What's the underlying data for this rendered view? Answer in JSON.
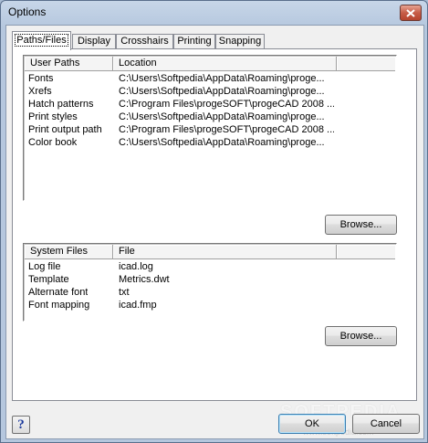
{
  "window": {
    "title": "Options"
  },
  "tabs": [
    {
      "label": "Paths/Files",
      "active": true
    },
    {
      "label": "Display"
    },
    {
      "label": "Crosshairs"
    },
    {
      "label": "Printing"
    },
    {
      "label": "Snapping"
    }
  ],
  "user_paths": {
    "columns": [
      "User Paths",
      "Location"
    ],
    "rows": [
      [
        "Fonts",
        "C:\\Users\\Softpedia\\AppData\\Roaming\\proge..."
      ],
      [
        "Xrefs",
        "C:\\Users\\Softpedia\\AppData\\Roaming\\proge..."
      ],
      [
        "Hatch patterns",
        "C:\\Program Files\\progeSOFT\\progeCAD 2008 ..."
      ],
      [
        "Print styles",
        "C:\\Users\\Softpedia\\AppData\\Roaming\\proge..."
      ],
      [
        "Print output path",
        "C:\\Program Files\\progeSOFT\\progeCAD 2008 ..."
      ],
      [
        "Color book",
        "C:\\Users\\Softpedia\\AppData\\Roaming\\proge..."
      ]
    ],
    "browse_label": "Browse..."
  },
  "system_files": {
    "columns": [
      "System Files",
      "File"
    ],
    "rows": [
      [
        "Log file",
        "icad.log"
      ],
      [
        "Template",
        "Metrics.dwt"
      ],
      [
        "Alternate font",
        "txt"
      ],
      [
        "Font mapping",
        "icad.fmp"
      ]
    ],
    "browse_label": "Browse..."
  },
  "footer": {
    "help_label": "?",
    "ok_label": "OK",
    "cancel_label": "Cancel"
  },
  "watermark": {
    "brand": "SOFTPEDIA",
    "url": "www.softpedia.com"
  }
}
